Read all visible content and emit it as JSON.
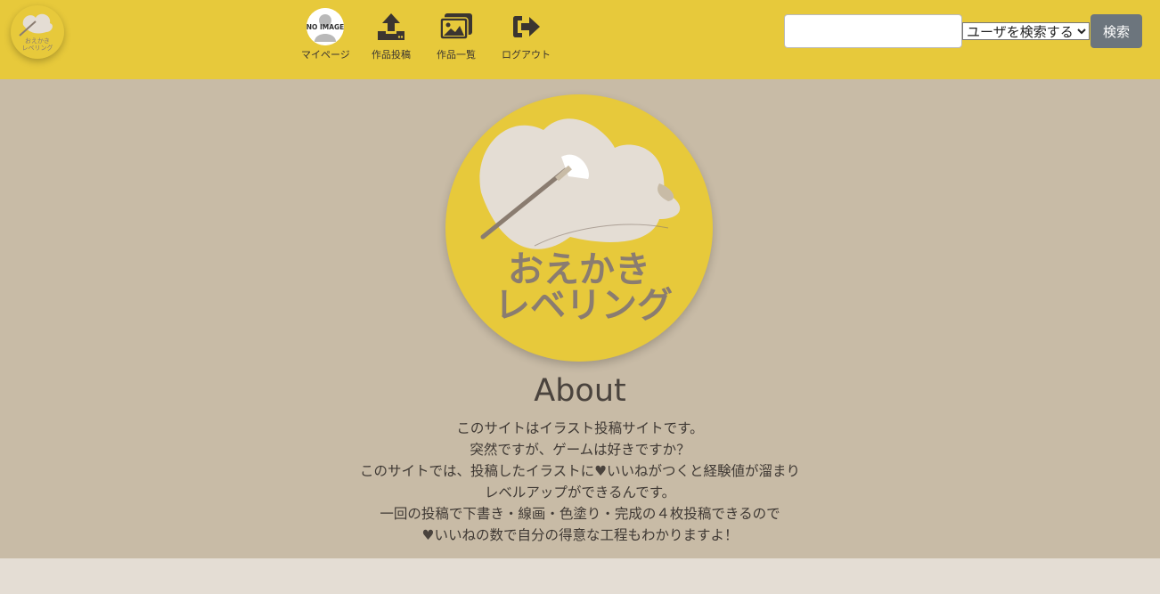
{
  "header": {
    "logo_text": "おえかきレベリング",
    "avatar_text": "NO IMAGE",
    "nav": [
      {
        "label": "マイページ",
        "icon": "avatar-icon"
      },
      {
        "label": "作品投稿",
        "icon": "upload-icon"
      },
      {
        "label": "作品一覧",
        "icon": "images-icon"
      },
      {
        "label": "ログアウト",
        "icon": "logout-icon"
      }
    ],
    "search": {
      "input_value": "",
      "placeholder": "",
      "select_value": "ユーザを検索する",
      "button_label": "検索"
    }
  },
  "hero": {
    "emblem_line1": "おえかき",
    "emblem_line2": "レベリング",
    "about_title": "About",
    "about_lines": [
      "このサイトはイラスト投稿サイトです。",
      "突然ですが、ゲームは好きですか？",
      "このサイトでは、投稿したイラストに",
      "いいねがつくと経験値が溜まり",
      "レベルアップができるんです。",
      "一回の投稿で下書き・線画・色塗り・完成の４枚投稿できるので",
      "いいねの数で自分の得意な工程もわかりますよ！"
    ]
  },
  "colors": {
    "header_bg": "#e7c93b",
    "hero_bg": "#c8bba6",
    "page_bg": "#e4ddd4",
    "button_bg": "#6c757d"
  }
}
